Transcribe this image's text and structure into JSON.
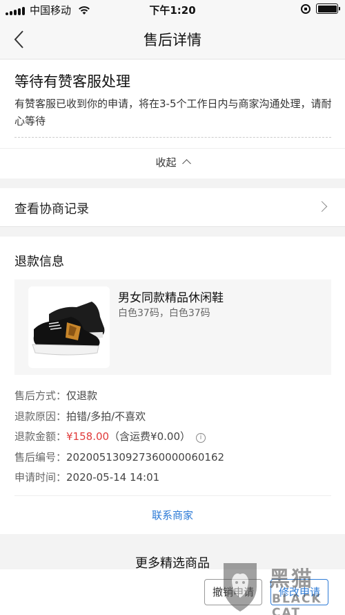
{
  "status_bar": {
    "carrier": "中国移动",
    "time": "下午1:20"
  },
  "nav": {
    "title": "售后详情"
  },
  "status_card": {
    "title": "等待有赞客服处理",
    "description": "有赞客服已收到你的申请，将在3-5个工作日内与商家沟通处理，请耐心等待",
    "collapse_label": "收起"
  },
  "negotiation": {
    "label": "查看协商记录"
  },
  "refund": {
    "section_title": "退款信息",
    "product": {
      "name": "男女同款精品休闲鞋",
      "spec": "白色37码，白色37码"
    },
    "rows": [
      {
        "label": "售后方式：",
        "value": "仅退款"
      },
      {
        "label": "退款原因：",
        "value": "拍错/多拍/不喜欢"
      },
      {
        "label": "退款金额：",
        "price": "¥158.00",
        "extra": "（含运费¥0.00）"
      },
      {
        "label": "售后编号：",
        "value": "202005130927360000060162"
      },
      {
        "label": "申请时间：",
        "value": "2020-05-14 14:01"
      }
    ],
    "contact_label": "联系商家"
  },
  "more": {
    "title": "更多精选商品"
  },
  "actions": {
    "cancel_label": "撤销申请",
    "modify_label": "修改申请"
  },
  "watermark": {
    "text": "黑猫",
    "sub": "BLACK CAT"
  },
  "colors": {
    "accent": "#2c7ad6",
    "price": "#e03b3b"
  }
}
